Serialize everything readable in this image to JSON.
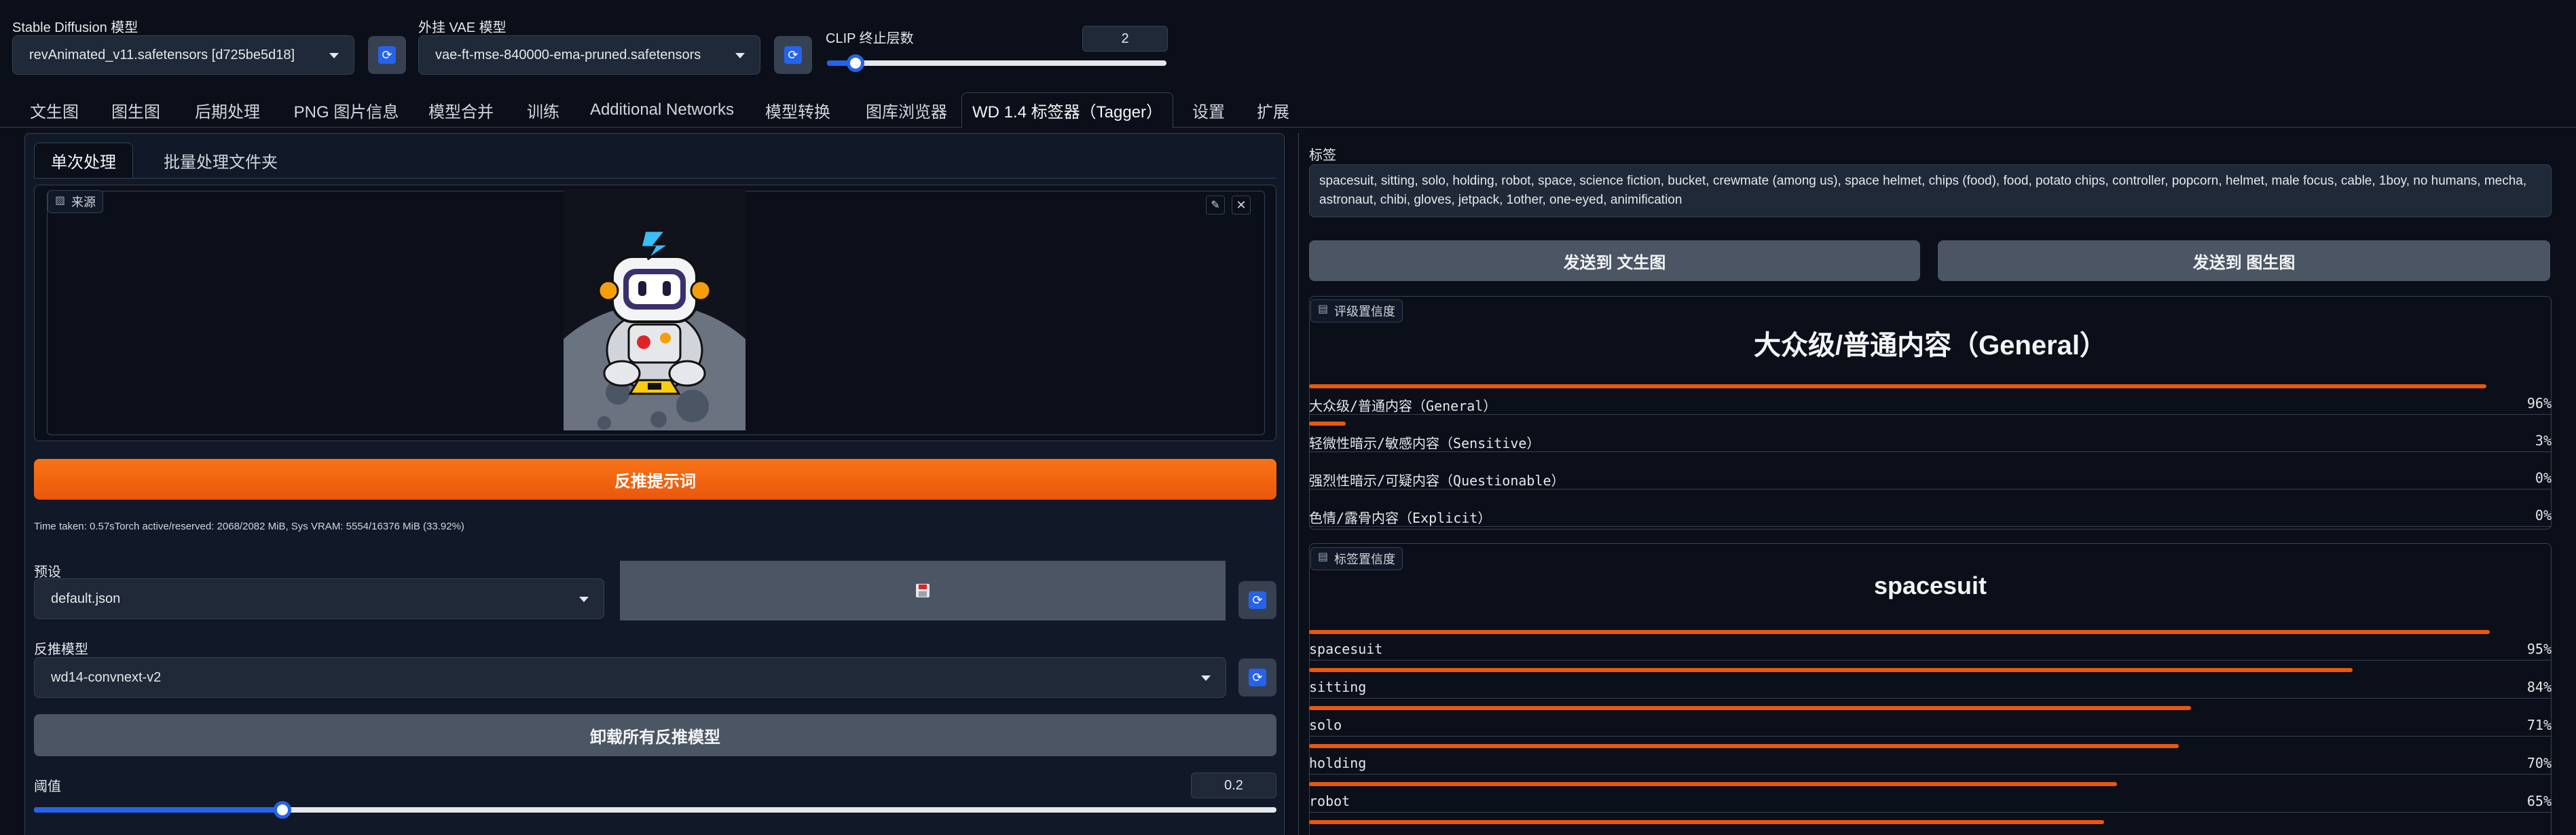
{
  "header": {
    "sd_model": {
      "label": "Stable Diffusion 模型",
      "value": "revAnimated_v11.safetensors [d725be5d18]"
    },
    "vae": {
      "label": "外挂 VAE 模型",
      "value": "vae-ft-mse-840000-ema-pruned.safetensors"
    },
    "clip": {
      "label": "CLIP 终止层数",
      "value": "2",
      "fraction": 0.083
    }
  },
  "tabs": [
    {
      "label": "文生图"
    },
    {
      "label": "图生图"
    },
    {
      "label": "后期处理"
    },
    {
      "label": "PNG 图片信息"
    },
    {
      "label": "模型合并"
    },
    {
      "label": "训练"
    },
    {
      "label": "Additional Networks"
    },
    {
      "label": "模型转换"
    },
    {
      "label": "图库浏览器"
    },
    {
      "label": "WD 1.4 标签器（Tagger）"
    },
    {
      "label": "设置"
    },
    {
      "label": "扩展"
    }
  ],
  "left": {
    "subtabs": [
      "单次处理",
      "批量处理文件夹"
    ],
    "source_label": "来源",
    "interrogate_button": "反推提示词",
    "time_info": "Time taken: 0.57sTorch active/reserved: 2068/2082 MiB, Sys VRAM: 5554/16376 MiB (33.92%)",
    "preset": {
      "label": "预设",
      "value": "default.json"
    },
    "model": {
      "label": "反推模型",
      "value": "wd14-convnext-v2"
    },
    "unload_button": "卸载所有反推模型",
    "threshold": {
      "label": "阈值",
      "value": "0.2",
      "fraction": 0.2
    }
  },
  "right": {
    "tags_label": "标签",
    "tags_text": "spacesuit, sitting, solo, holding, robot, space, science fiction, bucket, crewmate (among us), space helmet, chips (food), food, potato chips, controller, popcorn, helmet, male focus, cable, 1boy, no humans, mecha, astronaut, chibi, gloves, jetpack, 1other, one-eyed, animification",
    "send_txt2img": "发送到 文生图",
    "send_img2img": "发送到 图生图",
    "rating": {
      "badge": "评级置信度",
      "top": "大众级/普通内容（General）",
      "rows": [
        {
          "name": "大众级/普通内容（General）",
          "pct": "96%",
          "value": 0.96
        },
        {
          "name": "轻微性暗示/敏感内容（Sensitive）",
          "pct": "3%",
          "value": 0.03
        },
        {
          "name": "强烈性暗示/可疑内容（Questionable）",
          "pct": "0%",
          "value": 0.0
        },
        {
          "name": "色情/露骨内容（Explicit）",
          "pct": "0%",
          "value": 0.0
        }
      ]
    },
    "tagconf": {
      "badge": "标签置信度",
      "top": "spacesuit",
      "rows": [
        {
          "name": "spacesuit",
          "pct": "95%",
          "value": 0.95
        },
        {
          "name": "sitting",
          "pct": "84%",
          "value": 0.84
        },
        {
          "name": "solo",
          "pct": "71%",
          "value": 0.71
        },
        {
          "name": "holding",
          "pct": "70%",
          "value": 0.7
        },
        {
          "name": "robot",
          "pct": "65%",
          "value": 0.65
        }
      ],
      "partial_value": 0.64
    }
  },
  "colors": {
    "accent": "#ea580c",
    "primary": "#2563eb",
    "background": "#0b0f19"
  }
}
